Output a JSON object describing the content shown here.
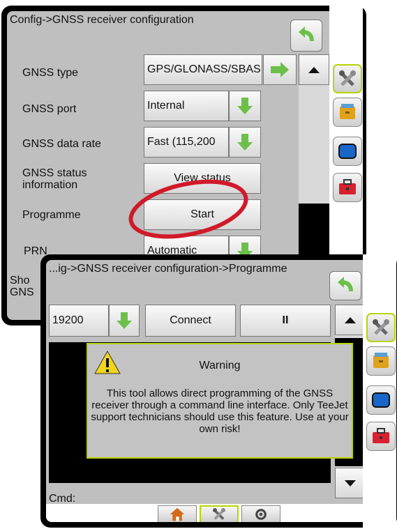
{
  "config_window": {
    "title": "Config->GNSS receiver configuration",
    "rows": [
      {
        "label": "GNSS type",
        "value": "GPS/GLONASS/SBAS"
      },
      {
        "label": "GNSS port",
        "value": "Internal"
      },
      {
        "label": "GNSS data rate",
        "value": "Fast (115,200"
      },
      {
        "label": "GNSS status information",
        "value": "View status"
      },
      {
        "label": "Programme",
        "value": "Start"
      },
      {
        "label": "PRN",
        "value": "Automatic"
      },
      {
        "label": "Sho GNS",
        "value": ""
      }
    ]
  },
  "programme_window": {
    "title": "...ig->GNSS receiver configuration->Programme",
    "baud_value": "19200",
    "connect_label": "Connect",
    "pause_label": "II",
    "cmd_label": "Cmd:"
  },
  "warning": {
    "title": "Warning",
    "message": "This tool allows direct programming of the GNSS receiver through a command line interface. Only TeeJet support technicians should use this feature. Use at your own risk!"
  },
  "colors": {
    "highlight_border": "#b8d400",
    "annotation_circle": "#d01a2a",
    "green_arrow": "#6cc04a"
  },
  "icons": {
    "back": "back-arrow-icon",
    "tools": "tools-icon",
    "storage": "storage-icon",
    "display": "display-icon",
    "toolbox": "toolbox-icon",
    "home": "home-icon",
    "settings": "gear-icon"
  }
}
